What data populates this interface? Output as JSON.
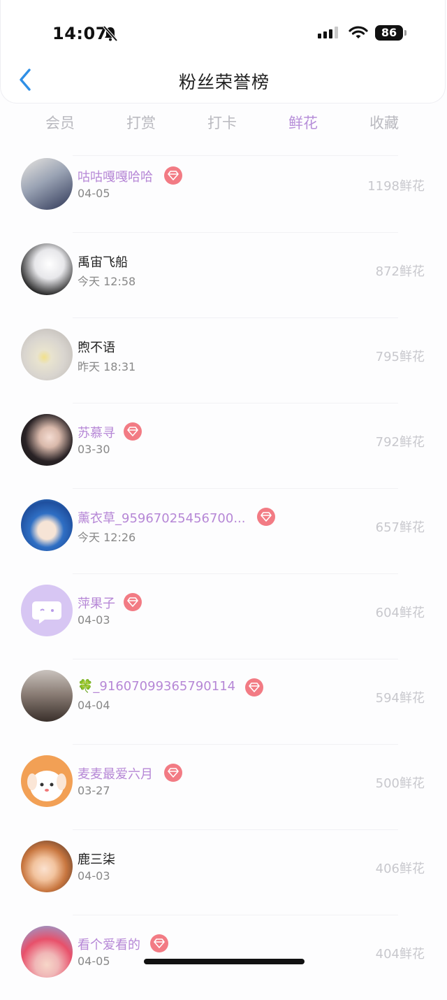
{
  "status_bar": {
    "time": "14:07",
    "battery": "86"
  },
  "nav": {
    "title": "粉丝荣誉榜"
  },
  "tabs": [
    {
      "label": "会员",
      "active": false
    },
    {
      "label": "打赏",
      "active": false
    },
    {
      "label": "打卡",
      "active": false
    },
    {
      "label": "鲜花",
      "active": true
    },
    {
      "label": "收藏",
      "active": false
    }
  ],
  "rows": [
    {
      "name": "咕咕嘎嘎哈哈",
      "date": "04-05",
      "amount": "1198鲜花",
      "vip": true
    },
    {
      "name": "禹宙飞船",
      "date": "今天 12:58",
      "amount": "872鲜花",
      "vip": false
    },
    {
      "name": "煦不语",
      "date": "昨天 18:31",
      "amount": "795鲜花",
      "vip": false
    },
    {
      "name": "苏慕寻",
      "date": "03-30",
      "amount": "792鲜花",
      "vip": true
    },
    {
      "name": "薰衣草_95967025456700...",
      "date": "今天 12:26",
      "amount": "657鲜花",
      "vip": true
    },
    {
      "name": "萍果子",
      "date": "04-03",
      "amount": "604鲜花",
      "vip": true
    },
    {
      "name": "🍀_91607099365790114",
      "date": "04-04",
      "amount": "594鲜花",
      "vip": true
    },
    {
      "name": "麦麦最爱六月",
      "date": "03-27",
      "amount": "500鲜花",
      "vip": true
    },
    {
      "name": "鹿三柒",
      "date": "04-03",
      "amount": "406鲜花",
      "vip": false
    },
    {
      "name": "看个爱看的",
      "date": "04-05",
      "amount": "404鲜花",
      "vip": true
    }
  ]
}
